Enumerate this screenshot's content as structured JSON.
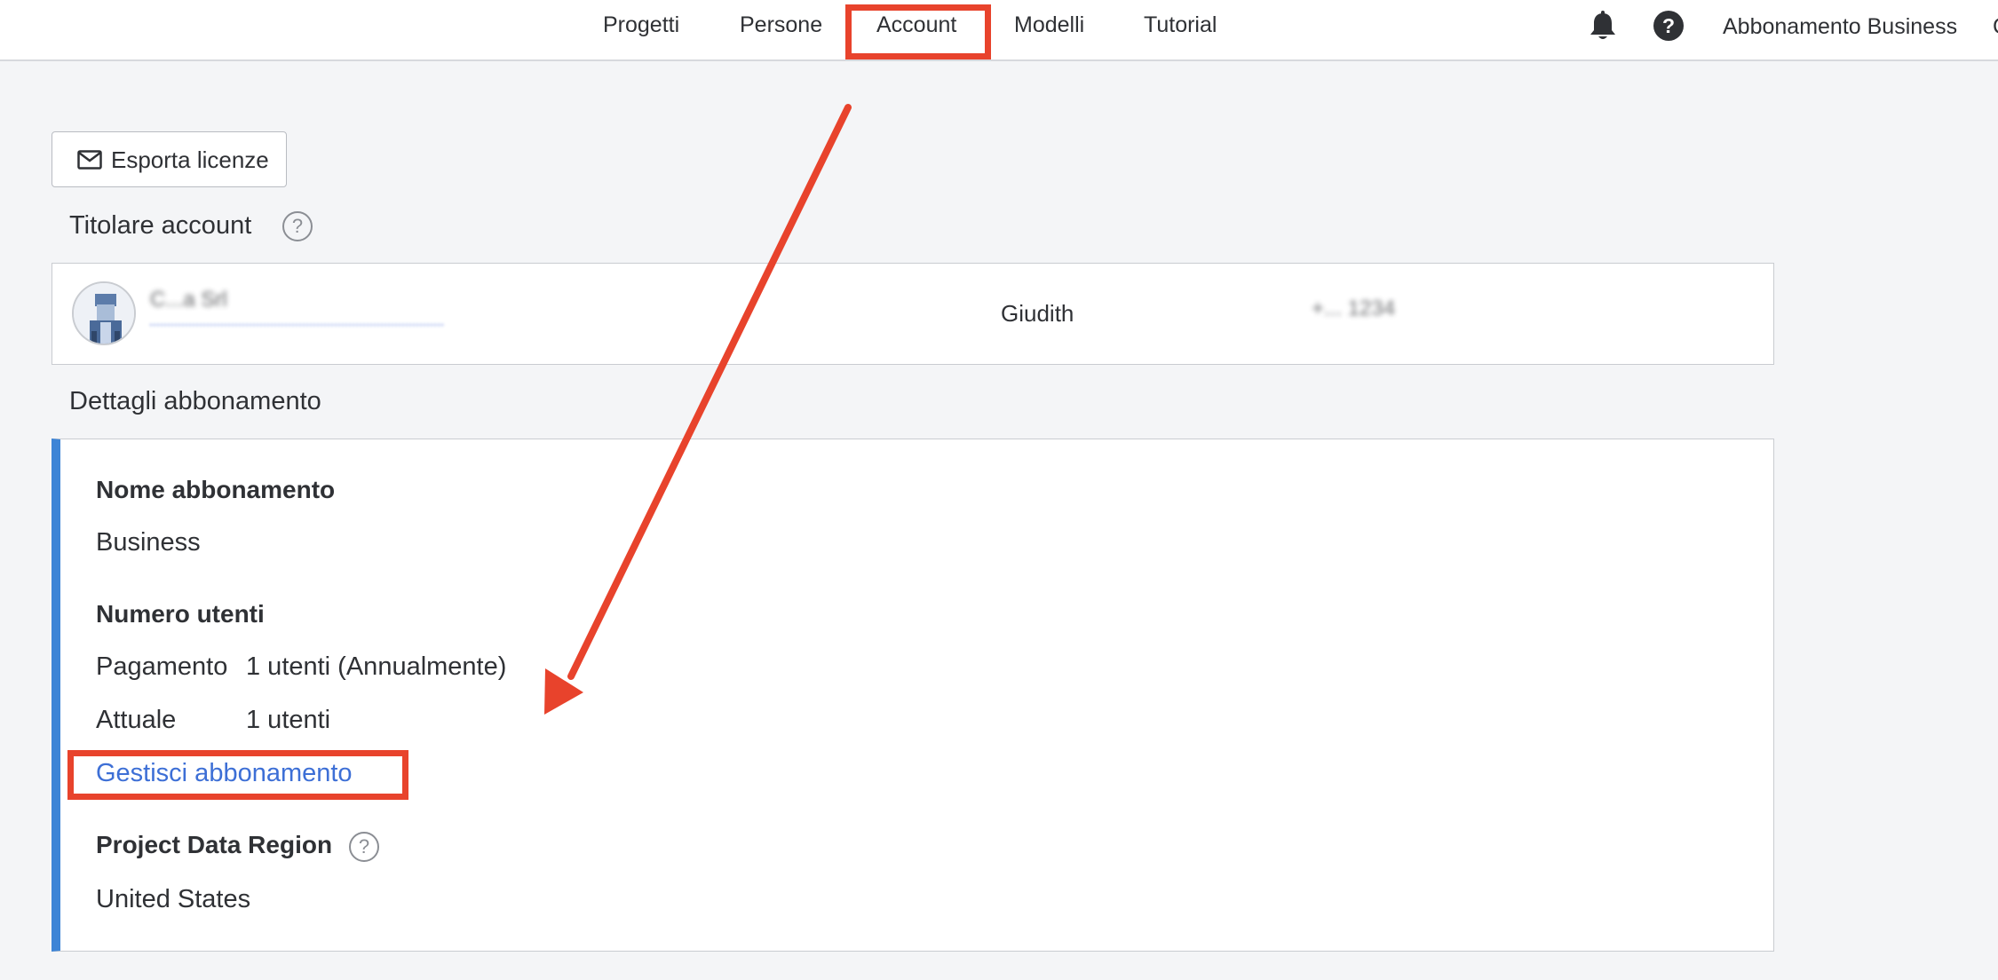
{
  "nav": {
    "items": [
      "Progetti",
      "Persone",
      "Account",
      "Modelli",
      "Tutorial"
    ],
    "plan_label": "Abbonamento Business",
    "help_symbol": "?",
    "icons": [
      "bell-icon",
      "help-icon"
    ]
  },
  "toolbar": {
    "export_label": "Esporta licenze",
    "export_icon": "mail-icon"
  },
  "owner": {
    "heading": "Titolare account",
    "help_symbol": "?",
    "name_obscured": "C...a Srl",
    "first_name": "Giudith",
    "phone_obscured": "+... 1234"
  },
  "subscription": {
    "heading": "Dettagli abbonamento",
    "name_label": "Nome abbonamento",
    "name_value": "Business",
    "users_label": "Numero utenti",
    "payment_label": "Pagamento",
    "payment_value": "1 utenti (Annualmente)",
    "current_label": "Attuale",
    "current_value": "1 utenti",
    "manage_link": "Gestisci abbonamento",
    "region_label": "Project Data Region",
    "region_help_symbol": "?",
    "region_value": "United States"
  },
  "colors": {
    "accent_blue": "#3d84d6",
    "link_blue": "#3d6fd6",
    "annotation_red": "#e8432c",
    "page_bg": "#f4f5f7"
  }
}
